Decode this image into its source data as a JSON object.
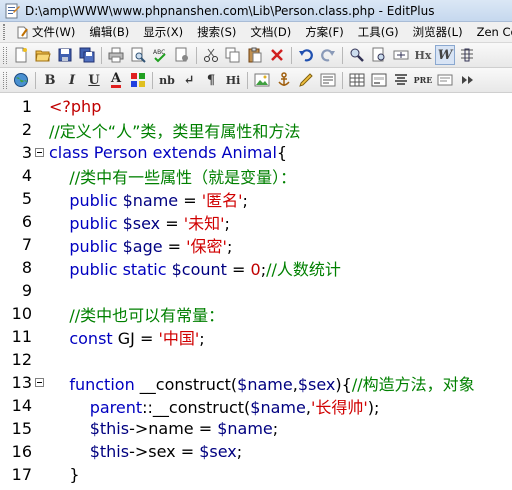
{
  "window": {
    "title": "D:\\amp\\WWW\\www.phpnanshen.com\\Lib\\Person.class.php - EditPlus"
  },
  "menu": [
    {
      "label": "文件(W)"
    },
    {
      "label": "编辑(B)"
    },
    {
      "label": "显示(X)"
    },
    {
      "label": "搜索(S)"
    },
    {
      "label": "文档(D)"
    },
    {
      "label": "方案(F)"
    },
    {
      "label": "工具(G)"
    },
    {
      "label": "浏览器(L)"
    },
    {
      "label": "Zen Co"
    }
  ],
  "toolbar1": [
    "new-file-icon",
    "open-file-icon",
    "save-icon",
    "save-all-icon",
    "print-icon",
    "print-preview-icon",
    "spell-check-icon",
    "cut-icon",
    "copy-icon",
    "paste-icon",
    "delete-icon",
    "undo-icon",
    "redo-icon",
    "find-icon",
    "replace-icon",
    "zoom-icon",
    "hex-icon",
    "word-wrap-icon",
    "column-icon"
  ],
  "toolbar2": [
    "browser-icon",
    "bold-icon",
    "italic-icon",
    "underline-icon",
    "font-color-icon",
    "color-picker-icon",
    "nbsp-icon",
    "line-break-icon",
    "paragraph-icon",
    "heading-icon",
    "image-icon",
    "anchor-icon",
    "edit-icon",
    "quote-icon",
    "table-icon",
    "list-icon",
    "center-icon",
    "pre-icon",
    "more-icon"
  ],
  "toolbar2_text": {
    "bold": "B",
    "italic": "I",
    "underline": "U",
    "font_color": "A",
    "nbsp": "nb",
    "line_break": "↵",
    "paragraph": "¶",
    "heading": "Hi",
    "pre": "PRE"
  },
  "toolbar1_text": {
    "hex": "Hx",
    "word_wrap": "W"
  },
  "editor": {
    "lines": [
      {
        "n": "1",
        "fold": false,
        "tokens": [
          [
            "tag",
            "<?php"
          ]
        ]
      },
      {
        "n": "2",
        "fold": false,
        "tokens": [
          [
            "cmt",
            "//定义个“人”类，类里有属性和方法"
          ]
        ]
      },
      {
        "n": "3",
        "fold": true,
        "tokens": [
          [
            "kw",
            "class Person extends Animal"
          ],
          [
            "op",
            "{"
          ]
        ]
      },
      {
        "n": "4",
        "fold": false,
        "tokens": [
          [
            "op",
            "    "
          ],
          [
            "cmt",
            "//类中有一些属性（就是变量）："
          ]
        ]
      },
      {
        "n": "5",
        "fold": false,
        "tokens": [
          [
            "op",
            "    "
          ],
          [
            "kw",
            "public "
          ],
          [
            "var",
            "$name"
          ],
          [
            "op",
            " = "
          ],
          [
            "str",
            "'匿名'"
          ],
          [
            "op",
            ";"
          ]
        ]
      },
      {
        "n": "6",
        "fold": false,
        "tokens": [
          [
            "op",
            "    "
          ],
          [
            "kw",
            "public "
          ],
          [
            "var",
            "$sex"
          ],
          [
            "op",
            " = "
          ],
          [
            "str",
            "'未知'"
          ],
          [
            "op",
            ";"
          ]
        ]
      },
      {
        "n": "7",
        "fold": false,
        "tokens": [
          [
            "op",
            "    "
          ],
          [
            "kw",
            "public "
          ],
          [
            "var",
            "$age"
          ],
          [
            "op",
            " = "
          ],
          [
            "str",
            "'保密'"
          ],
          [
            "op",
            ";"
          ]
        ]
      },
      {
        "n": "8",
        "fold": false,
        "tokens": [
          [
            "op",
            "    "
          ],
          [
            "kw",
            "public static "
          ],
          [
            "var",
            "$count"
          ],
          [
            "op",
            " = "
          ],
          [
            "num",
            "0"
          ],
          [
            "op",
            ";"
          ],
          [
            "cmt",
            "//人数统计"
          ]
        ]
      },
      {
        "n": "9",
        "fold": false,
        "tokens": []
      },
      {
        "n": "10",
        "fold": false,
        "tokens": [
          [
            "op",
            "    "
          ],
          [
            "cmt",
            "//类中也可以有常量："
          ]
        ]
      },
      {
        "n": "11",
        "fold": false,
        "tokens": [
          [
            "op",
            "    "
          ],
          [
            "kw",
            "const "
          ],
          [
            "op",
            "GJ = "
          ],
          [
            "str",
            "'中国'"
          ],
          [
            "op",
            ";"
          ]
        ]
      },
      {
        "n": "12",
        "fold": false,
        "tokens": []
      },
      {
        "n": "13",
        "fold": true,
        "tokens": [
          [
            "op",
            "    "
          ],
          [
            "kw",
            "function "
          ],
          [
            "op",
            "__construct("
          ],
          [
            "var",
            "$name"
          ],
          [
            "op",
            ","
          ],
          [
            "var",
            "$sex"
          ],
          [
            "op",
            ")"
          ],
          [
            "op",
            "{"
          ],
          [
            "cmt",
            "//构造方法，对象"
          ]
        ]
      },
      {
        "n": "14",
        "fold": false,
        "tokens": [
          [
            "op",
            "        "
          ],
          [
            "kw",
            "parent"
          ],
          [
            "op",
            "::__construct("
          ],
          [
            "var",
            "$name"
          ],
          [
            "op",
            ","
          ],
          [
            "str",
            "'长得帅'"
          ],
          [
            "op",
            ");"
          ]
        ]
      },
      {
        "n": "15",
        "fold": false,
        "tokens": [
          [
            "op",
            "        "
          ],
          [
            "var",
            "$this"
          ],
          [
            "op",
            "->name = "
          ],
          [
            "var",
            "$name"
          ],
          [
            "op",
            ";"
          ]
        ]
      },
      {
        "n": "16",
        "fold": false,
        "tokens": [
          [
            "op",
            "        "
          ],
          [
            "var",
            "$this"
          ],
          [
            "op",
            "->sex = "
          ],
          [
            "var",
            "$sex"
          ],
          [
            "op",
            ";"
          ]
        ]
      },
      {
        "n": "17",
        "fold": false,
        "tokens": [
          [
            "op",
            "    }"
          ]
        ]
      }
    ]
  }
}
